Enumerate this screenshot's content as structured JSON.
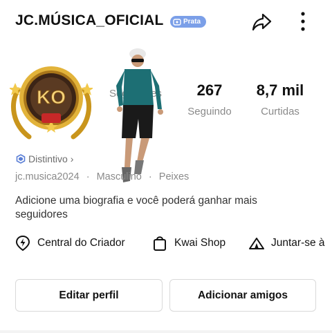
{
  "header": {
    "username": "JC.MÚSICA_OFICIAL",
    "badge_label": "Prata",
    "icons": {
      "share": "share-icon",
      "more": "more-vertical-icon"
    }
  },
  "avatar": {
    "text": "KO",
    "icon": "ko-gold-badge-avatar"
  },
  "stats": [
    {
      "value": "",
      "label": "Seguidores"
    },
    {
      "value": "267",
      "label": "Seguindo"
    },
    {
      "value": "8,7 mil",
      "label": "Curtidas"
    }
  ],
  "distintivo": {
    "label": "Distintivo",
    "chevron": "›"
  },
  "meta": {
    "handle": "jc.musica2024",
    "sep1": "·",
    "gender": "Masculino",
    "sep2": "·",
    "sign": "Peixes"
  },
  "bio": "Adicione uma biografia e você poderá ganhar mais seguidores",
  "actions": [
    {
      "label": "Central do Criador",
      "icon": "lightning-pin-icon"
    },
    {
      "label": "Kwai Shop",
      "icon": "shopping-bag-icon"
    },
    {
      "label": "Juntar-se à",
      "icon": "tent-icon"
    }
  ],
  "buttons": {
    "edit": "Editar perfil",
    "add_friends": "Adicionar amigos"
  },
  "colors": {
    "badge": "#7b9fe8",
    "accent_gold": "#d4a017",
    "muted": "#8a8a8a"
  }
}
